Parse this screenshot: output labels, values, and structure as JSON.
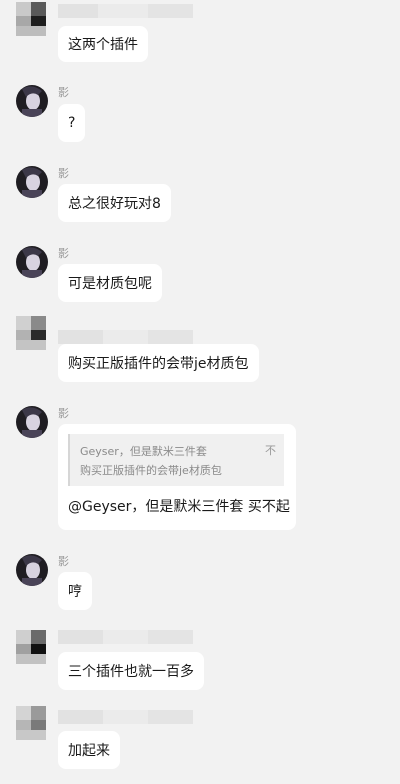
{
  "messages": [
    {
      "sender": "",
      "text": "这两个插件"
    },
    {
      "sender": "影",
      "text": "?"
    },
    {
      "sender": "影",
      "text": "总之很好玩对8"
    },
    {
      "sender": "影",
      "text": "可是材质包呢"
    },
    {
      "sender": "",
      "text": "购买正版插件的会带je材质包"
    },
    {
      "sender": "影",
      "text": "@Geyser，但是默米三件套 买不起",
      "quote": {
        "line1": "Geyser，但是默米三件套",
        "line2": "购买正版插件的会带je材质包",
        "close_label": "不"
      }
    },
    {
      "sender": "影",
      "text": "哼"
    },
    {
      "sender": "",
      "text": "三个插件也就一百多"
    },
    {
      "sender": "",
      "text": "加起来"
    }
  ],
  "colors": {
    "background": "#f2f2f2",
    "bubble": "#ffffff",
    "name_text": "#999999",
    "quote_bg": "#f0f0f0"
  },
  "icons": {
    "avatar_ying": "dark-portrait-avatar",
    "avatar_other": "pixelated-avatar"
  }
}
